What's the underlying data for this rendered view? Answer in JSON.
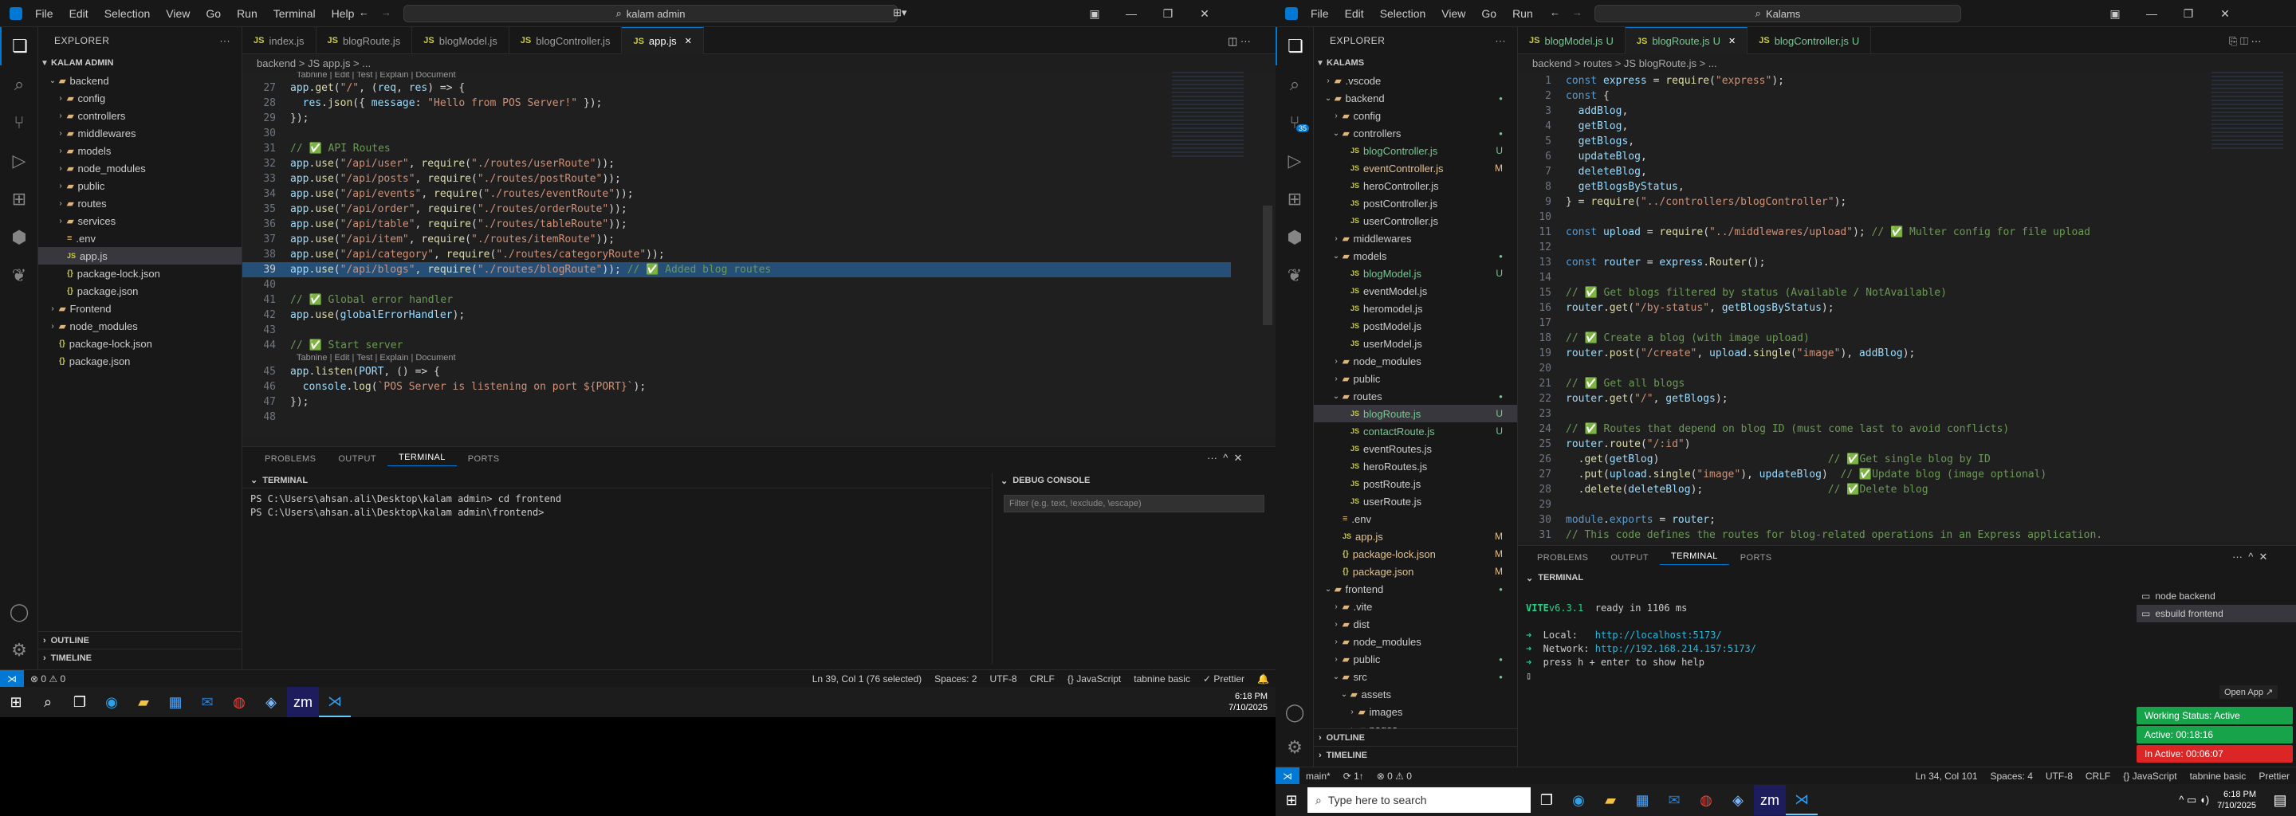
{
  "left": {
    "menu": [
      "File",
      "Edit",
      "Selection",
      "View",
      "Go",
      "Run",
      "Terminal",
      "Help"
    ],
    "search": "kalam admin",
    "explorer_title": "EXPLORER",
    "root": "KALAM ADMIN",
    "tree": [
      {
        "label": "backend",
        "type": "folder-open",
        "depth": 1
      },
      {
        "label": "config",
        "type": "folder",
        "depth": 2
      },
      {
        "label": "controllers",
        "type": "folder",
        "depth": 2
      },
      {
        "label": "middlewares",
        "type": "folder",
        "depth": 2
      },
      {
        "label": "models",
        "type": "folder",
        "depth": 2
      },
      {
        "label": "node_modules",
        "type": "folder",
        "depth": 2
      },
      {
        "label": "public",
        "type": "folder",
        "depth": 2
      },
      {
        "label": "routes",
        "type": "folder",
        "depth": 2
      },
      {
        "label": "services",
        "type": "folder",
        "depth": 2
      },
      {
        "label": ".env",
        "type": "file",
        "depth": 2
      },
      {
        "label": "app.js",
        "type": "js",
        "depth": 2,
        "selected": true
      },
      {
        "label": "package-lock.json",
        "type": "json",
        "depth": 2
      },
      {
        "label": "package.json",
        "type": "json",
        "depth": 2
      },
      {
        "label": "Frontend",
        "type": "folder",
        "depth": 1
      },
      {
        "label": "node_modules",
        "type": "folder",
        "depth": 1
      },
      {
        "label": "package-lock.json",
        "type": "json",
        "depth": 1
      },
      {
        "label": "package.json",
        "type": "json",
        "depth": 1
      }
    ],
    "outline": "OUTLINE",
    "timeline": "TIMELINE",
    "tabs": [
      {
        "label": "index.js",
        "active": false
      },
      {
        "label": "blogRoute.js",
        "active": false
      },
      {
        "label": "blogModel.js",
        "active": false
      },
      {
        "label": "blogController.js",
        "active": false
      },
      {
        "label": "app.js",
        "active": true
      }
    ],
    "breadcrumb": "backend > JS app.js > ...",
    "codelens_top": "Tabnine | Edit | Test | Explain | Document",
    "codelens_mid": "Tabnine | Edit | Test | Explain | Document",
    "code": [
      {
        "n": "27",
        "t": "app.get(\"/\", (req, res) => {"
      },
      {
        "n": "28",
        "t": "  res.json({ message: \"Hello from POS Server!\" });"
      },
      {
        "n": "29",
        "t": "});"
      },
      {
        "n": "30",
        "t": ""
      },
      {
        "n": "31",
        "t": "// ✅ API Routes"
      },
      {
        "n": "32",
        "t": "app.use(\"/api/user\", require(\"./routes/userRoute\"));"
      },
      {
        "n": "33",
        "t": "app.use(\"/api/posts\", require(\"./routes/postRoute\"));"
      },
      {
        "n": "34",
        "t": "app.use(\"/api/events\", require(\"./routes/eventRoute\"));"
      },
      {
        "n": "35",
        "t": "app.use(\"/api/order\", require(\"./routes/orderRoute\"));"
      },
      {
        "n": "36",
        "t": "app.use(\"/api/table\", require(\"./routes/tableRoute\"));"
      },
      {
        "n": "37",
        "t": "app.use(\"/api/item\", require(\"./routes/itemRoute\"));"
      },
      {
        "n": "38",
        "t": "app.use(\"/api/category\", require(\"./routes/categoryRoute\"));"
      },
      {
        "n": "39",
        "t": "app.use(\"/api/blogs\", require(\"./routes/blogRoute\")); // ✅ Added blog routes"
      },
      {
        "n": "40",
        "t": ""
      },
      {
        "n": "41",
        "t": "// ✅ Global error handler"
      },
      {
        "n": "42",
        "t": "app.use(globalErrorHandler);"
      },
      {
        "n": "43",
        "t": ""
      },
      {
        "n": "44",
        "t": "// ✅ Start server"
      },
      {
        "n": "45",
        "t": "app.listen(PORT, () => {"
      },
      {
        "n": "46",
        "t": "  console.log(`POS Server is listening on port ${PORT}`);"
      },
      {
        "n": "47",
        "t": "});"
      },
      {
        "n": "48",
        "t": ""
      }
    ],
    "panel_tabs": [
      "PROBLEMS",
      "OUTPUT",
      "TERMINAL",
      "PORTS"
    ],
    "terminal_label": "TERMINAL",
    "terminal": [
      "PS C:\\Users\\ahsan.ali\\Desktop\\kalam admin> cd frontend",
      "PS C:\\Users\\ahsan.ali\\Desktop\\kalam admin\\frontend> "
    ],
    "debug_label": "DEBUG CONSOLE",
    "debug_filter": "Filter (e.g. text, !exclude, \\escape)",
    "status": {
      "errors": "⊗ 0 ⚠ 0",
      "position": "Ln 39, Col 1 (76 selected)",
      "spaces": "Spaces: 2",
      "encoding": "UTF-8",
      "eol": "CRLF",
      "language": "{} JavaScript",
      "tabnine": "tabnine basic",
      "prettier": "✓ Prettier"
    },
    "clock": {
      "time": "6:18 PM",
      "date": "7/10/2025"
    }
  },
  "right": {
    "menu": [
      "File",
      "Edit",
      "Selection",
      "View",
      "Go",
      "Run"
    ],
    "search": "Kalams",
    "explorer_title": "EXPLORER",
    "root": "KALAMS",
    "tree": [
      {
        "label": ".vscode",
        "type": "folder",
        "depth": 1
      },
      {
        "label": "backend",
        "type": "folder-open",
        "depth": 1,
        "dot": true
      },
      {
        "label": "config",
        "type": "folder",
        "depth": 2
      },
      {
        "label": "controllers",
        "type": "folder-open",
        "depth": 2,
        "dot": true
      },
      {
        "label": "blogController.js",
        "type": "js",
        "depth": 3,
        "badge": "U",
        "color": "#73c991"
      },
      {
        "label": "eventController.js",
        "type": "js",
        "depth": 3,
        "badge": "M",
        "color": "#e2c08d"
      },
      {
        "label": "heroController.js",
        "type": "js",
        "depth": 3
      },
      {
        "label": "postController.js",
        "type": "js",
        "depth": 3
      },
      {
        "label": "userController.js",
        "type": "js",
        "depth": 3
      },
      {
        "label": "middlewares",
        "type": "folder",
        "depth": 2
      },
      {
        "label": "models",
        "type": "folder-open",
        "depth": 2,
        "dot": true
      },
      {
        "label": "blogModel.js",
        "type": "js",
        "depth": 3,
        "badge": "U",
        "color": "#73c991"
      },
      {
        "label": "eventModel.js",
        "type": "js",
        "depth": 3
      },
      {
        "label": "heromodel.js",
        "type": "js",
        "depth": 3
      },
      {
        "label": "postModel.js",
        "type": "js",
        "depth": 3
      },
      {
        "label": "userModel.js",
        "type": "js",
        "depth": 3
      },
      {
        "label": "node_modules",
        "type": "folder",
        "depth": 2
      },
      {
        "label": "public",
        "type": "folder",
        "depth": 2
      },
      {
        "label": "routes",
        "type": "folder-open",
        "depth": 2,
        "dot": true
      },
      {
        "label": "blogRoute.js",
        "type": "js",
        "depth": 3,
        "badge": "U",
        "color": "#73c991",
        "selected": true
      },
      {
        "label": "contactRoute.js",
        "type": "js",
        "depth": 3,
        "badge": "U",
        "color": "#73c991"
      },
      {
        "label": "eventRoutes.js",
        "type": "js",
        "depth": 3
      },
      {
        "label": "heroRoutes.js",
        "type": "js",
        "depth": 3
      },
      {
        "label": "postRoute.js",
        "type": "js",
        "depth": 3
      },
      {
        "label": "userRoute.js",
        "type": "js",
        "depth": 3
      },
      {
        "label": ".env",
        "type": "file",
        "depth": 2
      },
      {
        "label": "app.js",
        "type": "js",
        "depth": 2,
        "badge": "M",
        "color": "#e2c08d"
      },
      {
        "label": "package-lock.json",
        "type": "json",
        "depth": 2,
        "badge": "M",
        "color": "#e2c08d"
      },
      {
        "label": "package.json",
        "type": "json",
        "depth": 2,
        "badge": "M",
        "color": "#e2c08d"
      },
      {
        "label": "frontend",
        "type": "folder-open",
        "depth": 1,
        "dot": true
      },
      {
        "label": ".vite",
        "type": "folder",
        "depth": 2
      },
      {
        "label": "dist",
        "type": "folder",
        "depth": 2
      },
      {
        "label": "node_modules",
        "type": "folder",
        "depth": 2
      },
      {
        "label": "public",
        "type": "folder",
        "depth": 2,
        "dot": true
      },
      {
        "label": "src",
        "type": "folder-open",
        "depth": 2,
        "dot": true
      },
      {
        "label": "assets",
        "type": "folder-open",
        "depth": 3
      },
      {
        "label": "images",
        "type": "folder",
        "depth": 4
      },
      {
        "label": "pages",
        "type": "folder",
        "depth": 4
      }
    ],
    "outline": "OUTLINE",
    "timeline": "TIMELINE",
    "tabs": [
      {
        "label": "blogModel.js",
        "badge": "U",
        "active": false
      },
      {
        "label": "blogRoute.js",
        "badge": "U",
        "active": true
      },
      {
        "label": "blogController.js",
        "badge": "U",
        "active": false
      }
    ],
    "breadcrumb": "backend > routes > JS blogRoute.js > ...",
    "code": [
      {
        "n": "1",
        "t": "const express = require(\"express\");"
      },
      {
        "n": "2",
        "t": "const {"
      },
      {
        "n": "3",
        "t": "  addBlog,"
      },
      {
        "n": "4",
        "t": "  getBlog,"
      },
      {
        "n": "5",
        "t": "  getBlogs,"
      },
      {
        "n": "6",
        "t": "  updateBlog,"
      },
      {
        "n": "7",
        "t": "  deleteBlog,"
      },
      {
        "n": "8",
        "t": "  getBlogsByStatus,"
      },
      {
        "n": "9",
        "t": "} = require(\"../controllers/blogController\");"
      },
      {
        "n": "10",
        "t": ""
      },
      {
        "n": "11",
        "t": "const upload = require(\"../middlewares/upload\"); // ✅ Multer config for file upload"
      },
      {
        "n": "12",
        "t": ""
      },
      {
        "n": "13",
        "t": "const router = express.Router();"
      },
      {
        "n": "14",
        "t": ""
      },
      {
        "n": "15",
        "t": "// ✅ Get blogs filtered by status (Available / NotAvailable)"
      },
      {
        "n": "16",
        "t": "router.get(\"/by-status\", getBlogsByStatus);"
      },
      {
        "n": "17",
        "t": ""
      },
      {
        "n": "18",
        "t": "// ✅ Create a blog (with image upload)"
      },
      {
        "n": "19",
        "t": "router.post(\"/create\", upload.single(\"image\"), addBlog);"
      },
      {
        "n": "20",
        "t": ""
      },
      {
        "n": "21",
        "t": "// ✅ Get all blogs"
      },
      {
        "n": "22",
        "t": "router.get(\"/\", getBlogs);"
      },
      {
        "n": "23",
        "t": ""
      },
      {
        "n": "24",
        "t": "// ✅ Routes that depend on blog ID (must come last to avoid conflicts)"
      },
      {
        "n": "25",
        "t": "router.route(\"/:id\")"
      },
      {
        "n": "26",
        "t": "  .get(getBlog)                           // ✅Get single blog by ID"
      },
      {
        "n": "27",
        "t": "  .put(upload.single(\"image\"), updateBlog)  // ✅Update blog (image optional)"
      },
      {
        "n": "28",
        "t": "  .delete(deleteBlog);                    // ✅Delete blog"
      },
      {
        "n": "29",
        "t": ""
      },
      {
        "n": "30",
        "t": "module.exports = router;"
      },
      {
        "n": "31",
        "t": "// This code defines the routes for blog-related operations in an Express application."
      }
    ],
    "panel_tabs": [
      "PROBLEMS",
      "OUTPUT",
      "TERMINAL",
      "PORTS"
    ],
    "terminal_label": "TERMINAL",
    "terminal": [
      "",
      "  VITE v6.3.1  ready in 1106 ms",
      "",
      "  ➜  Local:   http://localhost:5173/",
      "  ➜  Network: http://192.168.214.157:5173/",
      "  ➜  press h + enter to show help",
      "▯"
    ],
    "terminals": [
      {
        "label": "node  backend"
      },
      {
        "label": "esbuild  frontend"
      }
    ],
    "open_app": "Open App ↗",
    "work": {
      "status": "Working Status: Active",
      "active": "Active: 00:18:16",
      "inactive": "In Active: 00:06:07"
    },
    "status": {
      "branch": "main*",
      "sync": "⟳ 1↑",
      "errors": "⊗ 0 ⚠ 0",
      "position": "Ln 34, Col 101",
      "spaces": "Spaces: 4",
      "encoding": "UTF-8",
      "eol": "CRLF",
      "language": "{} JavaScript",
      "tabnine": "tabnine basic",
      "prettier": "Prettier"
    },
    "taskbar_search": "Type here to search",
    "clock": {
      "time": "6:18 PM",
      "date": "7/10/2025"
    }
  },
  "colors": {
    "accent": "#0078d4",
    "keyword": "#569cd6",
    "string": "#ce9178",
    "comment": "#6a9955",
    "func": "#dcdcaa",
    "var": "#9cdcfe",
    "untracked": "#73c991",
    "modified": "#e2c08d",
    "selection": "#264f78",
    "work_active": "#16a34a",
    "work_inactive": "#dc2626"
  }
}
